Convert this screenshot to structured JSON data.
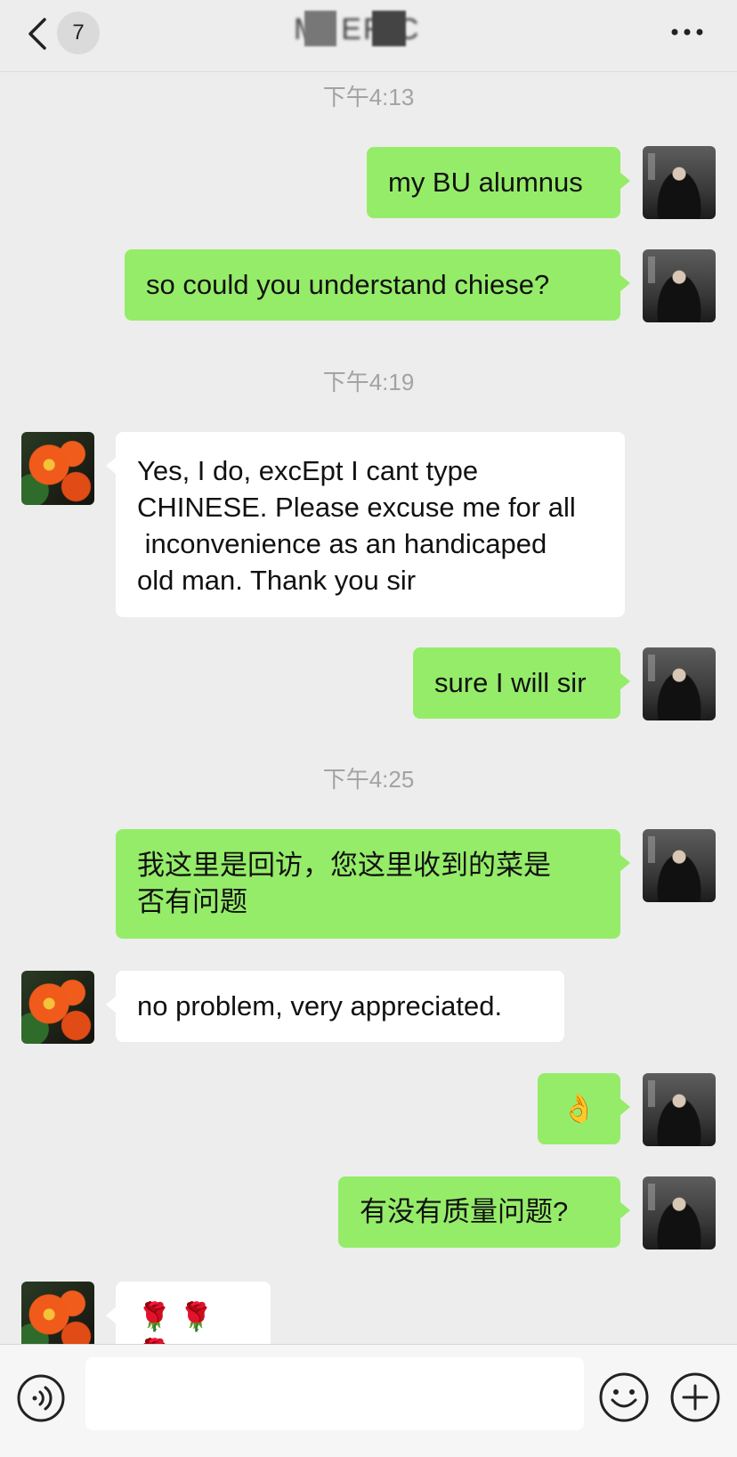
{
  "header": {
    "back_badge": "7",
    "title": "M. ERIC"
  },
  "messages": [
    {
      "type": "time",
      "text": "下午4:13"
    },
    {
      "type": "me",
      "text": "my BU alumnus"
    },
    {
      "type": "me",
      "text": "so could you understand chiese?"
    },
    {
      "type": "time",
      "text": "下午4:19"
    },
    {
      "type": "them",
      "text": "Yes, I do, excEpt I cant type\nCHINESE. Please excuse me for all\n inconvenience as an handicaped\nold man. Thank you sir"
    },
    {
      "type": "me",
      "text": "sure I will sir"
    },
    {
      "type": "time",
      "text": "下午4:25"
    },
    {
      "type": "me",
      "text": "我这里是回访，您这里收到的菜是\n否有问题"
    },
    {
      "type": "them",
      "text": "no problem, very appreciated."
    },
    {
      "type": "me",
      "text": "👌"
    },
    {
      "type": "me",
      "text": "有没有质量问题?"
    },
    {
      "type": "them",
      "text": "🌹 🌹 🌹"
    }
  ],
  "input": {
    "value": "",
    "placeholder": ""
  },
  "icons": {
    "back": "chevron-left-icon",
    "more": "more-dots-icon",
    "voice": "voice-icon",
    "emoji": "emoji-icon",
    "plus": "plus-icon"
  },
  "colors": {
    "background": "#ededed",
    "my_bubble": "#95ec69",
    "their_bubble": "#ffffff",
    "timestamp": "#a3a3a3"
  }
}
